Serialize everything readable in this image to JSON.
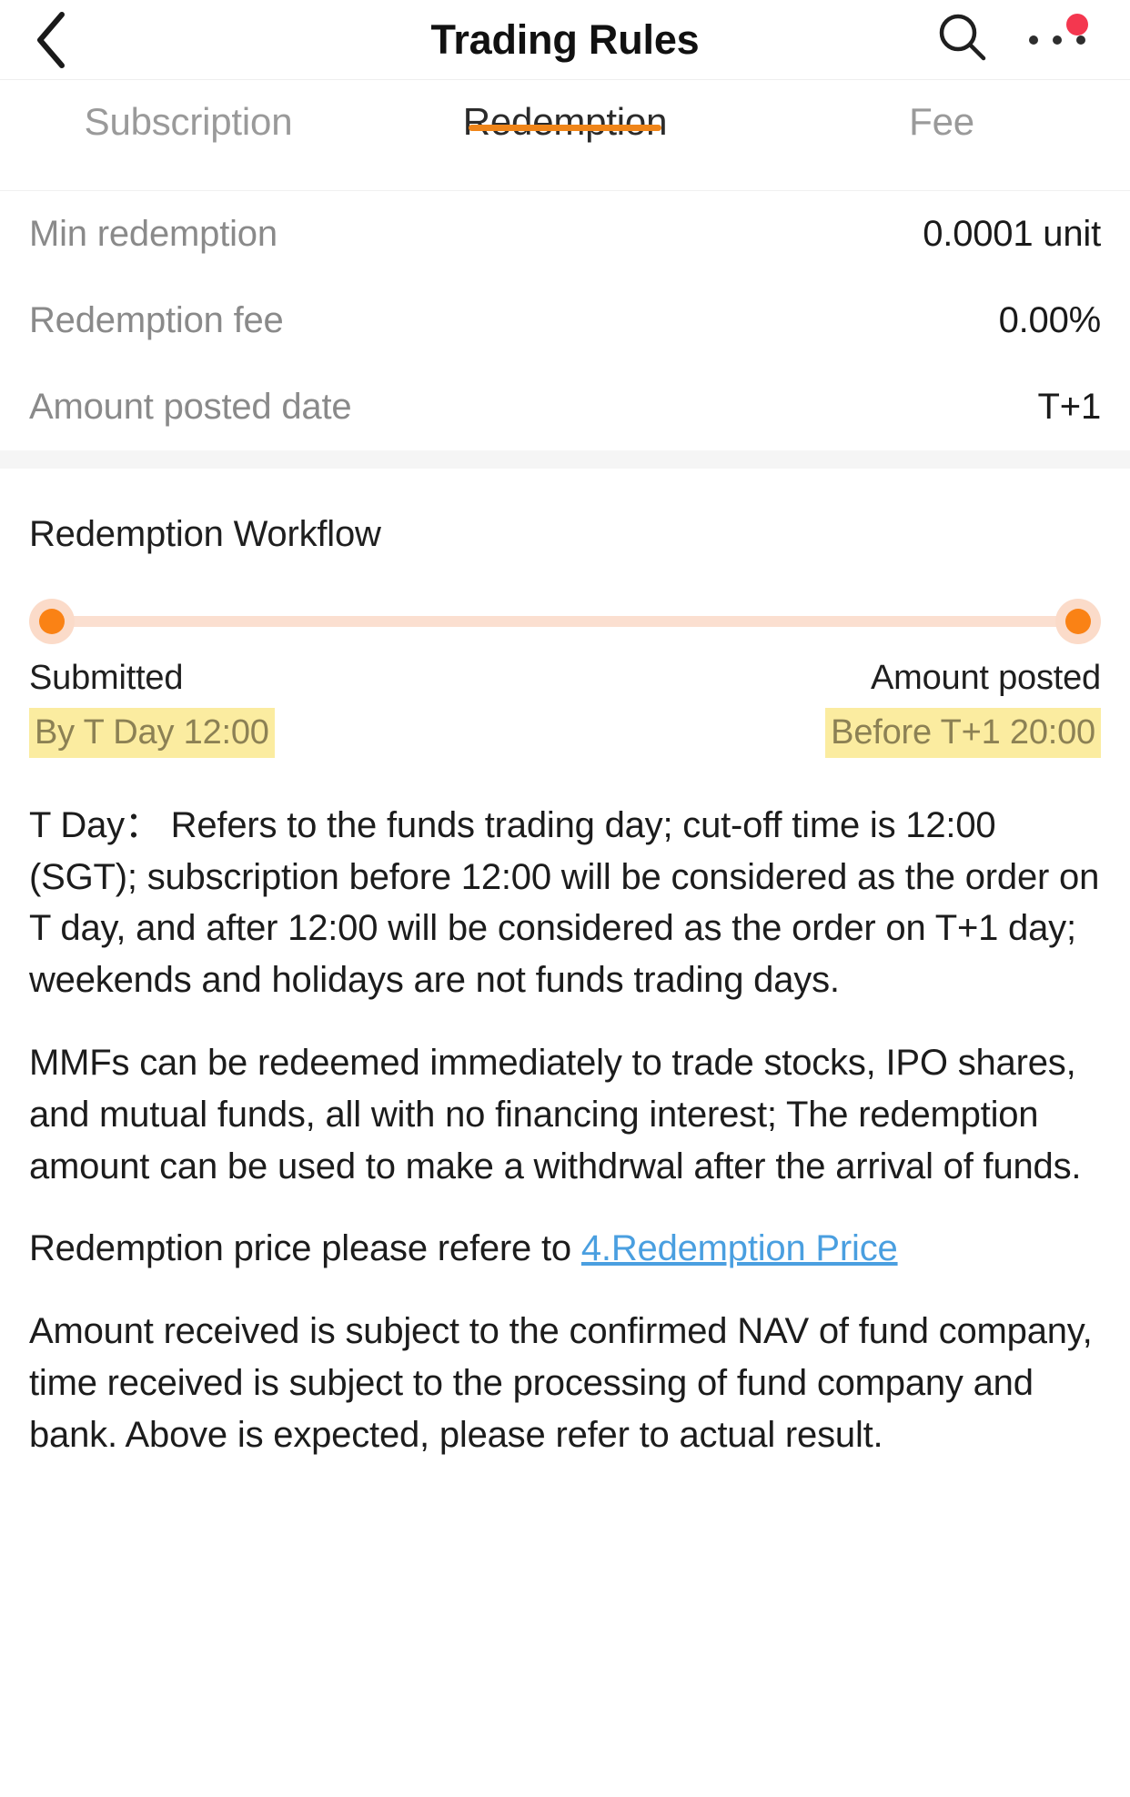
{
  "header": {
    "title": "Trading Rules",
    "back_icon": "chevron-left-icon",
    "search_icon": "search-icon",
    "more_icon": "more-horizontal-icon",
    "badge_color": "#f4374f",
    "has_badge": true
  },
  "tabs": [
    {
      "label": "Subscription",
      "active": false
    },
    {
      "label": "Redemption",
      "active": true
    },
    {
      "label": "Fee",
      "active": false
    }
  ],
  "accent_color": "#f08519",
  "info_rows": [
    {
      "label": "Min redemption",
      "value": "0.0001 unit"
    },
    {
      "label": "Redemption fee",
      "value": "0.00%"
    },
    {
      "label": "Amount posted date",
      "value": "T+1"
    }
  ],
  "workflow": {
    "title": "Redemption Workflow",
    "track_color": "#fbdfd0",
    "node_ring_color": "#fbdbc9",
    "node_core_color": "#fa8215",
    "highlight_color": "#fbeca0",
    "steps": [
      {
        "name": "Submitted",
        "time": "By T Day 12:00",
        "highlighted": true
      },
      {
        "name": "Amount posted",
        "time": "Before T+1 20:00",
        "highlighted": true
      }
    ]
  },
  "paragraphs": {
    "p1": "T Day：  Refers to the funds trading day; cut-off time is 12:00 (SGT); subscription before 12:00 will be considered as the order on T day,   and after 12:00 will be considered as the order on T+1 day; weekends and holidays are not funds trading days.",
    "p2": "MMFs can be redeemed immediately to trade stocks, IPO shares, and mutual funds, all with no financing interest; The redemption amount can be used to make a withdrwal after the arrival of funds.",
    "p3_prefix": "Redemption price please refere to ",
    "p3_link": "4.Redemption Price",
    "p4": "Amount received is subject to the confirmed NAV of fund company, time received is subject to the processing of fund company and bank. Above is expected, please refer to actual result."
  }
}
